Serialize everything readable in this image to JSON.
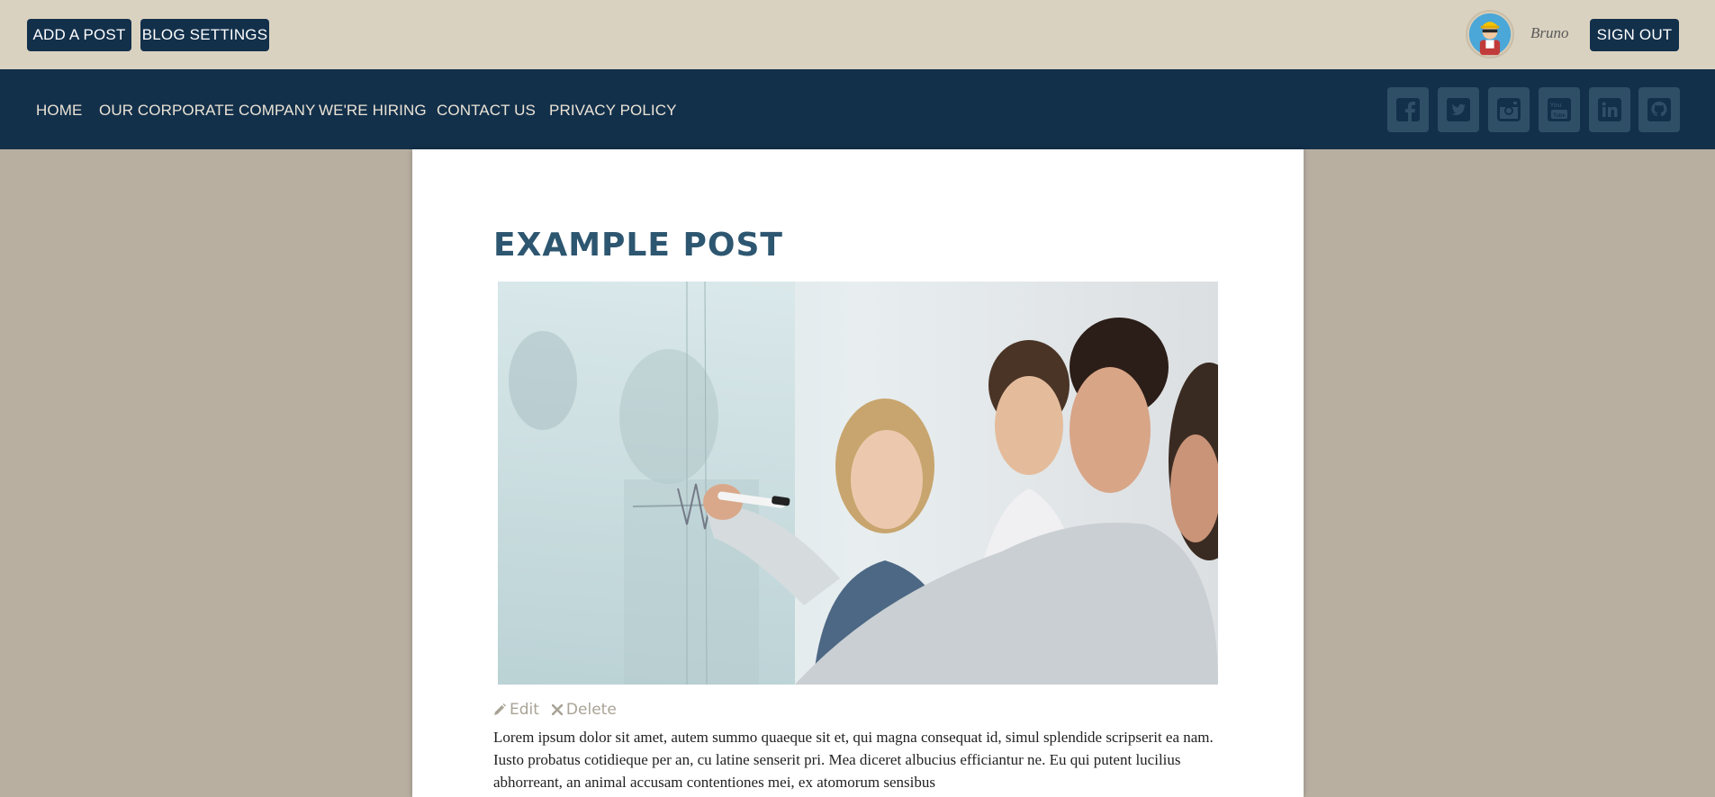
{
  "topbar": {
    "add_post_label": "ADD A POST",
    "blog_settings_label": "BLOG SETTINGS",
    "username": "Bruno",
    "sign_out_label": "SIGN OUT"
  },
  "nav": {
    "items": [
      {
        "label": "HOME"
      },
      {
        "label": "OUR CORPORATE COMPANY"
      },
      {
        "label": "WE'RE HIRING"
      },
      {
        "label": "CONTACT US"
      },
      {
        "label": "PRIVACY POLICY"
      }
    ],
    "social": [
      "facebook-icon",
      "twitter-icon",
      "instagram-icon",
      "youtube-icon",
      "linkedin-icon",
      "github-icon"
    ]
  },
  "post": {
    "title": "EXAMPLE POST",
    "image_alt": "Business team discussing at a glass board",
    "edit_label": "Edit",
    "delete_label": "Delete",
    "body": "Lorem ipsum dolor sit amet, autem summo quaeque sit et, qui magna consequat id, simul splendide scripserit ea nam. Iusto probatus cotidieque per an, cu latine senserit pri. Mea diceret albucius efficiantur ne. Eu qui putent lucilius abhorreant, an animal accusam contentiones mei, ex atomorum sensibus"
  },
  "colors": {
    "topbar_bg": "#dad2c0",
    "navbar_bg": "#13304b",
    "page_bg": "#b8afa1",
    "accent_title": "#2d5670",
    "social_tile": "#2f4f67"
  }
}
